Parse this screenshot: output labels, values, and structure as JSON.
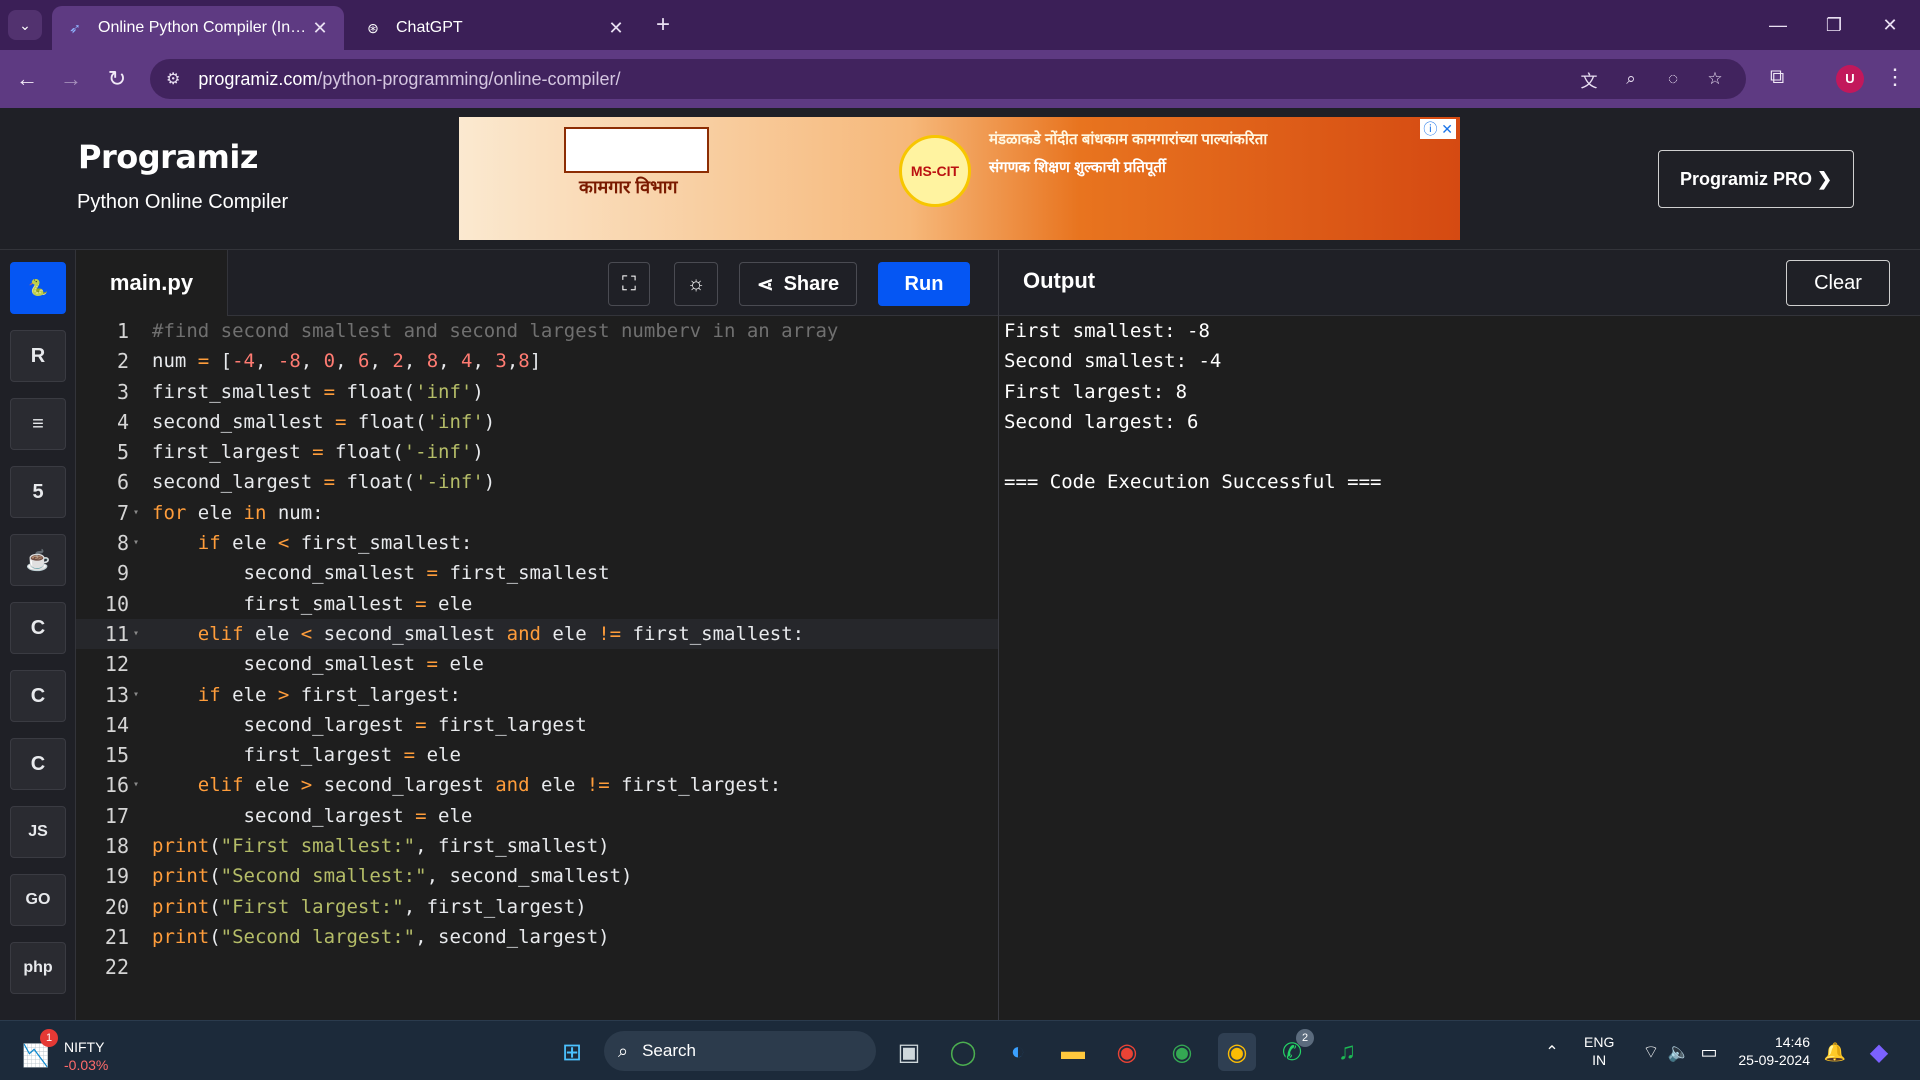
{
  "browser": {
    "tabs": [
      {
        "title": "Online Python Compiler (Interpreter)",
        "active": true
      },
      {
        "title": "ChatGPT",
        "active": false
      }
    ],
    "url_host": "programiz.com",
    "url_path": "/python-programming/online-compiler/"
  },
  "header": {
    "logo": "Programiz",
    "subtitle": "Python Online Compiler",
    "pro_button": "Programiz PRO ❯",
    "ad": {
      "department": "कामगार विभाग",
      "badge": "MS-CIT",
      "headline": "मंडळाकडे नोंदीत बांधकाम कामगारांच्या पाल्यांकरिता",
      "subline": "संगणक शिक्षण शुल्काची प्रतिपूर्ती"
    }
  },
  "rail": {
    "languages": [
      {
        "name": "python-icon",
        "glyph": "🐍",
        "active": true
      },
      {
        "name": "r-icon",
        "glyph": "R",
        "active": false
      },
      {
        "name": "sql-icon",
        "glyph": "≡",
        "active": false
      },
      {
        "name": "html-icon",
        "glyph": "5",
        "active": false
      },
      {
        "name": "java-icon",
        "glyph": "☕",
        "active": false
      },
      {
        "name": "c-icon",
        "glyph": "C",
        "active": false
      },
      {
        "name": "cpp-icon",
        "glyph": "C",
        "active": false
      },
      {
        "name": "csharp-icon",
        "glyph": "C",
        "active": false
      },
      {
        "name": "js-icon",
        "glyph": "JS",
        "active": false
      },
      {
        "name": "go-icon",
        "glyph": "GO",
        "active": false
      },
      {
        "name": "php-icon",
        "glyph": "php",
        "active": false
      }
    ]
  },
  "editor": {
    "filename": "main.py",
    "share_label": "Share",
    "run_label": "Run",
    "highlighted_line": 11,
    "lines": [
      {
        "n": "1",
        "fold": false,
        "tokens": [
          [
            "comment",
            "#find second smallest and second largest numberv in an array"
          ]
        ]
      },
      {
        "n": "2",
        "fold": false,
        "tokens": [
          [
            "id",
            "num "
          ],
          [
            "op",
            "="
          ],
          [
            "id",
            " ["
          ],
          [
            "num",
            "-4"
          ],
          [
            "id",
            ", "
          ],
          [
            "num",
            "-8"
          ],
          [
            "id",
            ", "
          ],
          [
            "num",
            "0"
          ],
          [
            "id",
            ", "
          ],
          [
            "num",
            "6"
          ],
          [
            "id",
            ", "
          ],
          [
            "num",
            "2"
          ],
          [
            "id",
            ", "
          ],
          [
            "num",
            "8"
          ],
          [
            "id",
            ", "
          ],
          [
            "num",
            "4"
          ],
          [
            "id",
            ", "
          ],
          [
            "num",
            "3"
          ],
          [
            "id",
            ","
          ],
          [
            "num",
            "8"
          ],
          [
            "id",
            "]"
          ]
        ]
      },
      {
        "n": "3",
        "fold": false,
        "tokens": [
          [
            "id",
            "first_smallest "
          ],
          [
            "op",
            "="
          ],
          [
            "id",
            " float("
          ],
          [
            "str",
            "'inf'"
          ],
          [
            "id",
            ")"
          ]
        ]
      },
      {
        "n": "4",
        "fold": false,
        "tokens": [
          [
            "id",
            "second_smallest "
          ],
          [
            "op",
            "="
          ],
          [
            "id",
            " float("
          ],
          [
            "str",
            "'inf'"
          ],
          [
            "id",
            ")"
          ]
        ]
      },
      {
        "n": "5",
        "fold": false,
        "tokens": [
          [
            "id",
            "first_largest "
          ],
          [
            "op",
            "="
          ],
          [
            "id",
            " float("
          ],
          [
            "str",
            "'-inf'"
          ],
          [
            "id",
            ")"
          ]
        ]
      },
      {
        "n": "6",
        "fold": false,
        "tokens": [
          [
            "id",
            "second_largest "
          ],
          [
            "op",
            "="
          ],
          [
            "id",
            " float("
          ],
          [
            "str",
            "'-inf'"
          ],
          [
            "id",
            ")"
          ]
        ]
      },
      {
        "n": "7",
        "fold": true,
        "tokens": [
          [
            "kw",
            "for"
          ],
          [
            "id",
            " ele "
          ],
          [
            "kw",
            "in"
          ],
          [
            "id",
            " num:"
          ]
        ]
      },
      {
        "n": "8",
        "fold": true,
        "tokens": [
          [
            "id",
            "    "
          ],
          [
            "kw",
            "if"
          ],
          [
            "id",
            " ele "
          ],
          [
            "op",
            "<"
          ],
          [
            "id",
            " first_smallest:"
          ]
        ]
      },
      {
        "n": "9",
        "fold": false,
        "tokens": [
          [
            "id",
            "        second_smallest "
          ],
          [
            "op",
            "="
          ],
          [
            "id",
            " first_smallest"
          ]
        ]
      },
      {
        "n": "10",
        "fold": false,
        "tokens": [
          [
            "id",
            "        first_smallest "
          ],
          [
            "op",
            "="
          ],
          [
            "id",
            " ele"
          ]
        ]
      },
      {
        "n": "11",
        "fold": true,
        "tokens": [
          [
            "id",
            "    "
          ],
          [
            "kw",
            "elif"
          ],
          [
            "id",
            " ele "
          ],
          [
            "op",
            "<"
          ],
          [
            "id",
            " second_smallest "
          ],
          [
            "kw",
            "and"
          ],
          [
            "id",
            " ele "
          ],
          [
            "op",
            "!="
          ],
          [
            "id",
            " first_smallest:"
          ]
        ]
      },
      {
        "n": "12",
        "fold": false,
        "tokens": [
          [
            "id",
            "        second_smallest "
          ],
          [
            "op",
            "="
          ],
          [
            "id",
            " ele"
          ]
        ]
      },
      {
        "n": "13",
        "fold": true,
        "tokens": [
          [
            "id",
            "    "
          ],
          [
            "kw",
            "if"
          ],
          [
            "id",
            " ele "
          ],
          [
            "op",
            ">"
          ],
          [
            "id",
            " first_largest:"
          ]
        ]
      },
      {
        "n": "14",
        "fold": false,
        "tokens": [
          [
            "id",
            "        second_largest "
          ],
          [
            "op",
            "="
          ],
          [
            "id",
            " first_largest"
          ]
        ]
      },
      {
        "n": "15",
        "fold": false,
        "tokens": [
          [
            "id",
            "        first_largest "
          ],
          [
            "op",
            "="
          ],
          [
            "id",
            " ele"
          ]
        ]
      },
      {
        "n": "16",
        "fold": true,
        "tokens": [
          [
            "id",
            "    "
          ],
          [
            "kw",
            "elif"
          ],
          [
            "id",
            " ele "
          ],
          [
            "op",
            ">"
          ],
          [
            "id",
            " second_largest "
          ],
          [
            "kw",
            "and"
          ],
          [
            "id",
            " ele "
          ],
          [
            "op",
            "!="
          ],
          [
            "id",
            " first_largest:"
          ]
        ]
      },
      {
        "n": "17",
        "fold": false,
        "tokens": [
          [
            "id",
            "        second_largest "
          ],
          [
            "op",
            "="
          ],
          [
            "id",
            " ele"
          ]
        ]
      },
      {
        "n": "18",
        "fold": false,
        "tokens": [
          [
            "kw",
            "print"
          ],
          [
            "id",
            "("
          ],
          [
            "str",
            "\"First smallest:\""
          ],
          [
            "id",
            ", first_smallest)"
          ]
        ]
      },
      {
        "n": "19",
        "fold": false,
        "tokens": [
          [
            "kw",
            "print"
          ],
          [
            "id",
            "("
          ],
          [
            "str",
            "\"Second smallest:\""
          ],
          [
            "id",
            ", second_smallest)"
          ]
        ]
      },
      {
        "n": "20",
        "fold": false,
        "tokens": [
          [
            "kw",
            "print"
          ],
          [
            "id",
            "("
          ],
          [
            "str",
            "\"First largest:\""
          ],
          [
            "id",
            ", first_largest)"
          ]
        ]
      },
      {
        "n": "21",
        "fold": false,
        "tokens": [
          [
            "kw",
            "print"
          ],
          [
            "id",
            "("
          ],
          [
            "str",
            "\"Second largest:\""
          ],
          [
            "id",
            ", second_largest)"
          ]
        ]
      },
      {
        "n": "22",
        "fold": false,
        "tokens": []
      }
    ]
  },
  "output": {
    "title": "Output",
    "clear_label": "Clear",
    "lines": [
      "First smallest: -8",
      "Second smallest: -4",
      "First largest: 8",
      "Second largest: 6",
      "",
      "=== Code Execution Successful ==="
    ]
  },
  "taskbar": {
    "stock_name": "NIFTY",
    "stock_change": "-0.03%",
    "stock_badge": "1",
    "search_label": "Search",
    "whatsapp_badge": "2",
    "lang_line1": "ENG",
    "lang_line2": "IN",
    "time": "14:46",
    "date": "25-09-2024"
  }
}
